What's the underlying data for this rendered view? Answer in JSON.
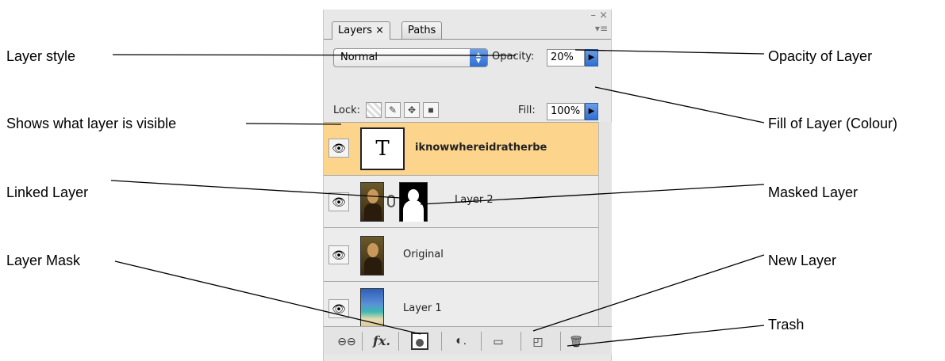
{
  "callouts": {
    "layer_style": "Layer style",
    "visible": "Shows what layer is visible",
    "linked": "Linked Layer",
    "layer_mask": "Layer Mask",
    "opacity": "Opacity of Layer",
    "fill": "Fill of Layer (Colour)",
    "masked": "Masked Layer",
    "new_layer": "New Layer",
    "trash": "Trash"
  },
  "panel": {
    "tabs": [
      {
        "label": "Layers ×"
      },
      {
        "label": "Paths"
      }
    ],
    "window_controls": "– ×",
    "menu_glyph": "▾≡",
    "blend_mode": "Normal",
    "opacity_label": "Opacity:",
    "opacity_value": "20%",
    "lock_label": "Lock:",
    "fill_label": "Fill:",
    "fill_value": "100%",
    "layers": [
      {
        "name": "iknowwhereidratherbe",
        "thumb": "T"
      },
      {
        "name": "Layer 2"
      },
      {
        "name": "Original"
      },
      {
        "name": "Layer 1"
      }
    ]
  },
  "icons": {
    "eye": "eye-icon",
    "link": "link-icon",
    "fx": "fx-icon",
    "mask": "mask-icon",
    "adjustment": "adjustment-icon",
    "folder": "folder-icon",
    "new": "new-layer-icon",
    "trash": "trash-icon"
  },
  "colors": {
    "selected_row": "#fdd48b",
    "accent_blue": "#2f6fd0"
  }
}
